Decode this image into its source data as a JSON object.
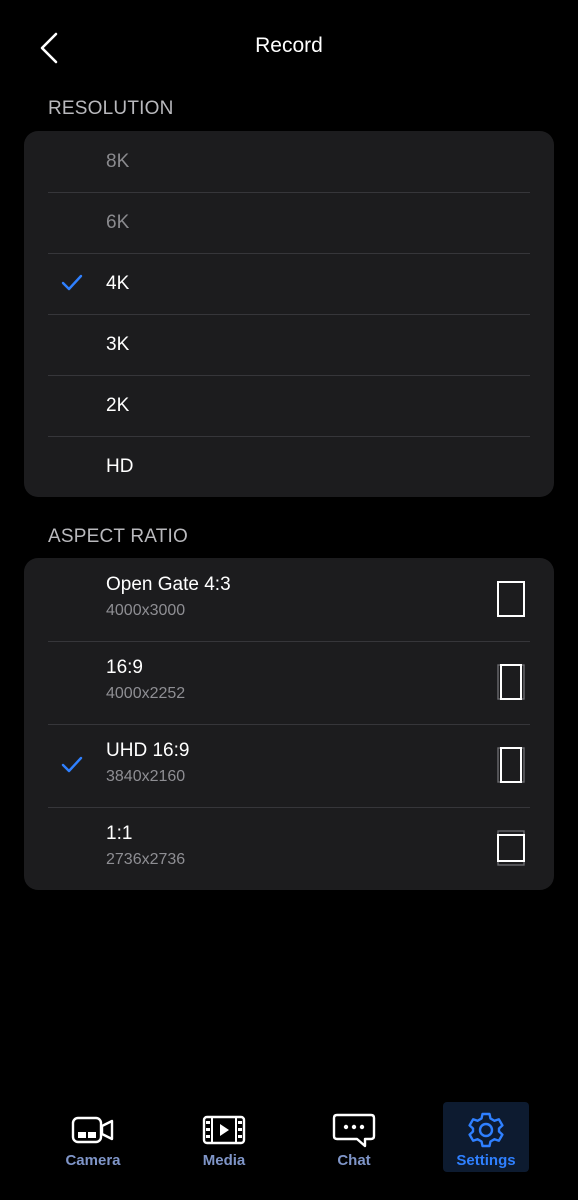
{
  "header": {
    "title": "Record"
  },
  "resolution": {
    "section_label": "RESOLUTION",
    "items": [
      {
        "label": "8K",
        "selected": false,
        "enabled": false
      },
      {
        "label": "6K",
        "selected": false,
        "enabled": false
      },
      {
        "label": "4K",
        "selected": true,
        "enabled": true
      },
      {
        "label": "3K",
        "selected": false,
        "enabled": true
      },
      {
        "label": "2K",
        "selected": false,
        "enabled": true
      },
      {
        "label": "HD",
        "selected": false,
        "enabled": true
      }
    ]
  },
  "aspect_ratio": {
    "section_label": "ASPECT RATIO",
    "items": [
      {
        "label": "Open Gate 4:3",
        "sub": "4000x3000",
        "selected": false,
        "icon": "aspect-4-3-icon"
      },
      {
        "label": "16:9",
        "sub": "4000x2252",
        "selected": false,
        "icon": "aspect-16-9-icon"
      },
      {
        "label": "UHD 16:9",
        "sub": "3840x2160",
        "selected": true,
        "icon": "aspect-uhd-16-9-icon"
      },
      {
        "label": "1:1",
        "sub": "2736x2736",
        "selected": false,
        "icon": "aspect-1-1-icon"
      }
    ]
  },
  "tabbar": {
    "items": [
      {
        "label": "Camera",
        "icon": "camera-icon",
        "active": false
      },
      {
        "label": "Media",
        "icon": "film-icon",
        "active": false
      },
      {
        "label": "Chat",
        "icon": "chat-bubble-icon",
        "active": false
      },
      {
        "label": "Settings",
        "icon": "gear-icon",
        "active": true
      }
    ]
  },
  "colors": {
    "accent": "#2f80ff",
    "card_bg": "#1c1c1e",
    "tab_inactive": "#7f95c8",
    "tab_active_bg": "#0d1b30"
  }
}
